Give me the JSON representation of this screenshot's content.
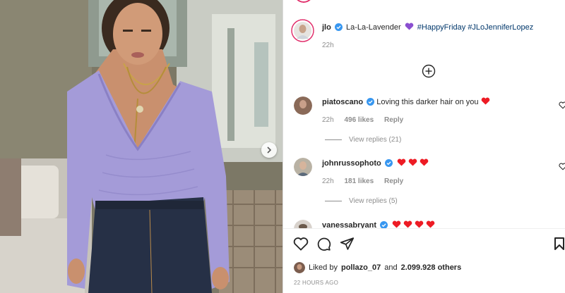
{
  "post": {
    "author": "jlo",
    "caption": "La-La-Lavender",
    "hashtags": [
      "#HappyFriday",
      "#JLoJenniferLopez"
    ],
    "time": "22h",
    "emoji_name": "purple-heart"
  },
  "comments": [
    {
      "username": "piatoscano",
      "text": "Loving this darker hair on you",
      "time": "22h",
      "likes": "496 likes",
      "reply": "Reply",
      "view_replies": "View replies (21)"
    },
    {
      "username": "johnrussophoto",
      "text": "",
      "time": "22h",
      "likes": "181 likes",
      "reply": "Reply",
      "view_replies": "View replies (5)"
    },
    {
      "username": "vanessabryant",
      "text": ""
    }
  ],
  "likes": {
    "prefix": "Liked by",
    "user": "pollazo_07",
    "and": "and",
    "count": "2.099.928 others"
  },
  "posted_ago": "22 HOURS AGO",
  "colors": {
    "verified": "#3897f0",
    "heart": "#ed1b24",
    "purple": "#8a4fd0",
    "hashtag": "#00376b"
  },
  "icons": [
    "verified-icon",
    "add-comments-icon",
    "heart-icon",
    "comment-icon",
    "share-icon",
    "bookmark-icon",
    "chevron-right-icon"
  ]
}
